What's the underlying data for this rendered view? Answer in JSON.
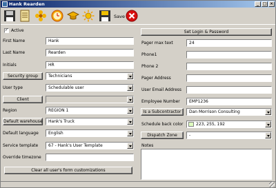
{
  "window": {
    "title": "Hank Rearden"
  },
  "toolbar": {
    "icons": [
      "save-disk-icon",
      "document-icon",
      "flower-icon",
      "clock-icon",
      "graduation-cap-icon",
      "sun-icon",
      "save-disk-icon",
      "cancel-icon"
    ],
    "save_label": "Save"
  },
  "left": {
    "active_label": "Active",
    "active_checked": true,
    "first_name_label": "First Name",
    "first_name_value": "Hank",
    "last_name_label": "Last Name",
    "last_name_value": "Rearden",
    "initials_label": "Initials",
    "initials_value": "HR",
    "security_group_button": "Security group",
    "security_group_value": "Technicians",
    "user_type_label": "User type",
    "user_type_value": "Schedulable user",
    "client_button": "Client",
    "client_value": "",
    "region_label": "Region",
    "region_value": "REGION 1",
    "default_warehouse_button": "Default warehouse",
    "default_warehouse_value": "Hank's Truck",
    "default_language_label": "Default language",
    "default_language_value": "English",
    "service_template_label": "Service template",
    "service_template_value": "67 - Hank's User Template",
    "override_timezone_label": "Override timezone",
    "override_timezone_value": "",
    "clear_button": "Clear all user's form customizations"
  },
  "right": {
    "set_login_button": "Set Login & Password",
    "pager_max_text_label": "Pager max text",
    "pager_max_text_value": "24",
    "phone1_label": "Phone1",
    "phone1_value": "",
    "phone2_label": "Phone 2",
    "phone2_value": "",
    "pager_address_label": "Pager Address",
    "pager_address_value": "",
    "user_email_label": "User Email Address",
    "user_email_value": "",
    "employee_number_label": "Employee Number",
    "employee_number_value": "EMP1236",
    "subcontractor_button": "Is a Subcontractor",
    "subcontractor_value": "Dan Morrison Consulting",
    "schedule_back_color_label": "Schedule back color",
    "schedule_back_color_value": "223, 255, 192",
    "schedule_back_color_hex": "#dfffc0",
    "dispatch_zone_button": "Dispatch Zone",
    "dispatch_zone_value": "-",
    "notes_label": "Notes"
  }
}
